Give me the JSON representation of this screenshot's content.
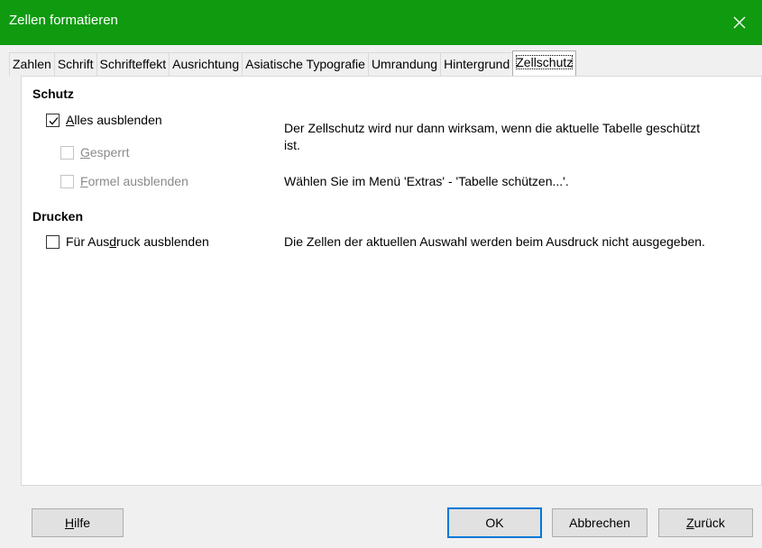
{
  "window": {
    "title": "Zellen formatieren",
    "accent_color": "#109a10"
  },
  "tabs": [
    {
      "label": "Zahlen"
    },
    {
      "label": "Schrift"
    },
    {
      "label": "Schrifteffekt"
    },
    {
      "label": "Ausrichtung"
    },
    {
      "label": "Asiatische Typografie"
    },
    {
      "label": "Umrandung"
    },
    {
      "label": "Hintergrund"
    },
    {
      "label": "Zellschutz",
      "active": true
    }
  ],
  "protection": {
    "heading": "Schutz",
    "hide_all": {
      "before": "",
      "mnemonic": "A",
      "after": "lles ausblenden",
      "checked": true
    },
    "locked": {
      "before": "",
      "mnemonic": "G",
      "after": "esperrt",
      "checked": false,
      "disabled": true
    },
    "hide_formula": {
      "before": "",
      "mnemonic": "F",
      "after": "ormel ausblenden",
      "checked": false,
      "disabled": true
    },
    "info_line1": "Der Zellschutz wird nur dann wirksam, wenn die aktuelle Tabelle geschützt",
    "info_line2": "ist.",
    "info_menu": "Wählen Sie im Menü 'Extras' - 'Tabelle schützen...'."
  },
  "print": {
    "heading": "Drucken",
    "hide_print": {
      "before": "Für Aus",
      "mnemonic": "d",
      "after": "ruck ausblenden",
      "checked": false
    },
    "info": "Die Zellen der aktuellen Auswahl werden beim Ausdruck nicht ausgegeben."
  },
  "buttons": {
    "help": {
      "before": "",
      "mnemonic": "H",
      "after": "ilfe"
    },
    "ok": "OK",
    "cancel": "Abbrechen",
    "back": {
      "before": "",
      "mnemonic": "Z",
      "after": "urück"
    }
  }
}
